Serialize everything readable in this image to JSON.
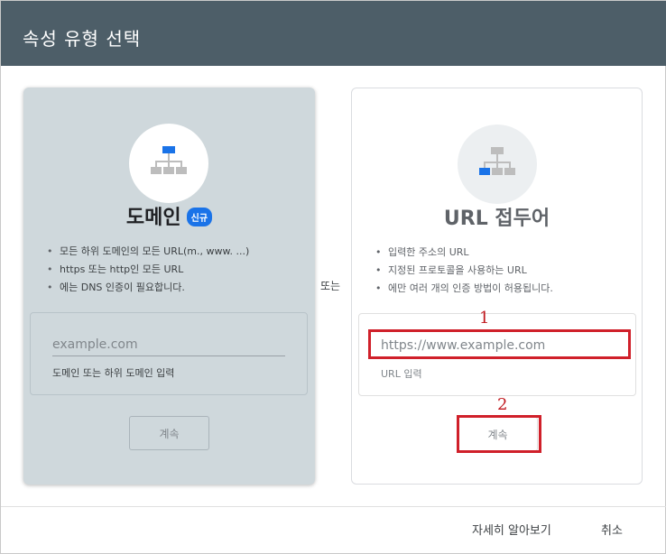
{
  "dialog": {
    "title": "속성 유형 선택",
    "or_label": "또는"
  },
  "domain_card": {
    "icon": "sitemap-icon",
    "title": "도메인",
    "badge": "신규",
    "bullets": [
      "모든 하위 도메인의 모든 URL(m., www. ...)",
      "https 또는 http인 모든 URL",
      "에는 DNS 인증이 필요합니다."
    ],
    "input_placeholder": "example.com",
    "input_value": "",
    "help_text": "도메인 또는 하위 도메인 입력",
    "continue_label": "계속"
  },
  "url_card": {
    "icon": "sitemap-icon",
    "title": "URL 접두어",
    "bullets": [
      "입력한 주소의 URL",
      "지정된 프로토콜을 사용하는 URL",
      "에만 여러 개의 인증 방법이 허용됩니다."
    ],
    "input_placeholder": "https://www.example.com",
    "input_value": "",
    "help_text": "URL 입력",
    "continue_label": "계속"
  },
  "annotations": {
    "step1": "1",
    "step2": "2",
    "color": "#d0202a"
  },
  "footer": {
    "learn_more_label": "자세히 알아보기",
    "cancel_label": "취소"
  },
  "colors": {
    "header_bg": "#4d5e68",
    "domain_card_bg": "#cfd8dc",
    "accent_blue": "#1a73e8"
  }
}
